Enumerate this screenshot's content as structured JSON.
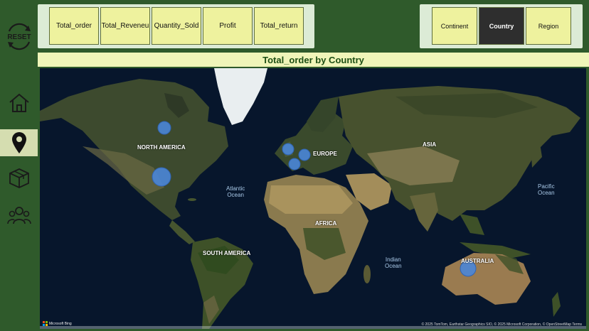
{
  "sidebar": {
    "reset_label": "RESET",
    "nav_items": [
      {
        "icon": "home-icon",
        "active": false
      },
      {
        "icon": "map-pin-icon",
        "active": true
      },
      {
        "icon": "box-icon",
        "active": false
      },
      {
        "icon": "people-icon",
        "active": false
      }
    ]
  },
  "metrics": [
    "Total_order",
    "Total_Reveneu",
    "Quantity_Sold",
    "Profit",
    "Total_return"
  ],
  "levels": [
    "Continent",
    "Country",
    "Region"
  ],
  "active_level": "Country",
  "title": "Total_order by Country",
  "map": {
    "continent_labels": [
      "NORTH AMERICA",
      "EUROPE",
      "ASIA",
      "AFRICA",
      "SOUTH AMERICA",
      "AUSTRALIA"
    ],
    "ocean_labels": [
      "Atlantic\nOcean",
      "Pacific\nOcean",
      "Indian\nOcean"
    ],
    "attribution": "© 2025 TomTom, Earthstar Geographics SIO, © 2025 Microsoft Corporation, © OpenStreetMap  Terms",
    "provider": "Microsoft Bing",
    "bubble_color": "#4a86d8"
  }
}
